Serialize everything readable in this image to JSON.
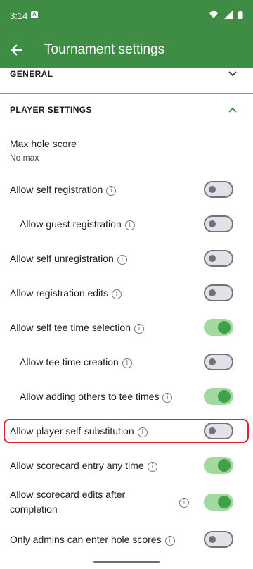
{
  "status_bar": {
    "time": "3:14",
    "notification_icon": "A"
  },
  "app_bar": {
    "title": "Tournament settings",
    "back_icon": "arrow-left-icon",
    "color": "#3f8c45"
  },
  "sections": {
    "general": {
      "label": "GENERAL",
      "expanded": false
    },
    "player_settings": {
      "label": "PLAYER SETTINGS",
      "expanded": true
    }
  },
  "max_hole_score": {
    "label": "Max hole score",
    "value": "No max"
  },
  "settings": [
    {
      "label": "Allow self registration",
      "enabled": false,
      "info": true
    },
    {
      "label": "Allow guest registration",
      "enabled": false,
      "info": true
    },
    {
      "label": "Allow self unregistration",
      "enabled": false,
      "info": true
    },
    {
      "label": "Allow registration edits",
      "enabled": false,
      "info": true
    },
    {
      "label": "Allow self tee time selection",
      "enabled": true,
      "info": true
    },
    {
      "label": "Allow tee time creation",
      "enabled": false,
      "info": true
    },
    {
      "label": "Allow adding others to tee times",
      "enabled": true,
      "info": true
    },
    {
      "label": "Allow player self-substitution",
      "enabled": false,
      "info": true,
      "highlighted": true
    },
    {
      "label": "Allow scorecard entry any time",
      "enabled": true,
      "info": true
    },
    {
      "label": "Allow scorecard edits after",
      "label_line2": "completion",
      "enabled": true,
      "info": true
    },
    {
      "label": "Only admins can enter hole scores",
      "enabled": false,
      "info": true
    }
  ],
  "colors": {
    "accent": "#3f8c45",
    "toggle_on_track": "#a3d8a1",
    "toggle_on_knob": "#3fa24a",
    "highlight": "#e0202c"
  }
}
